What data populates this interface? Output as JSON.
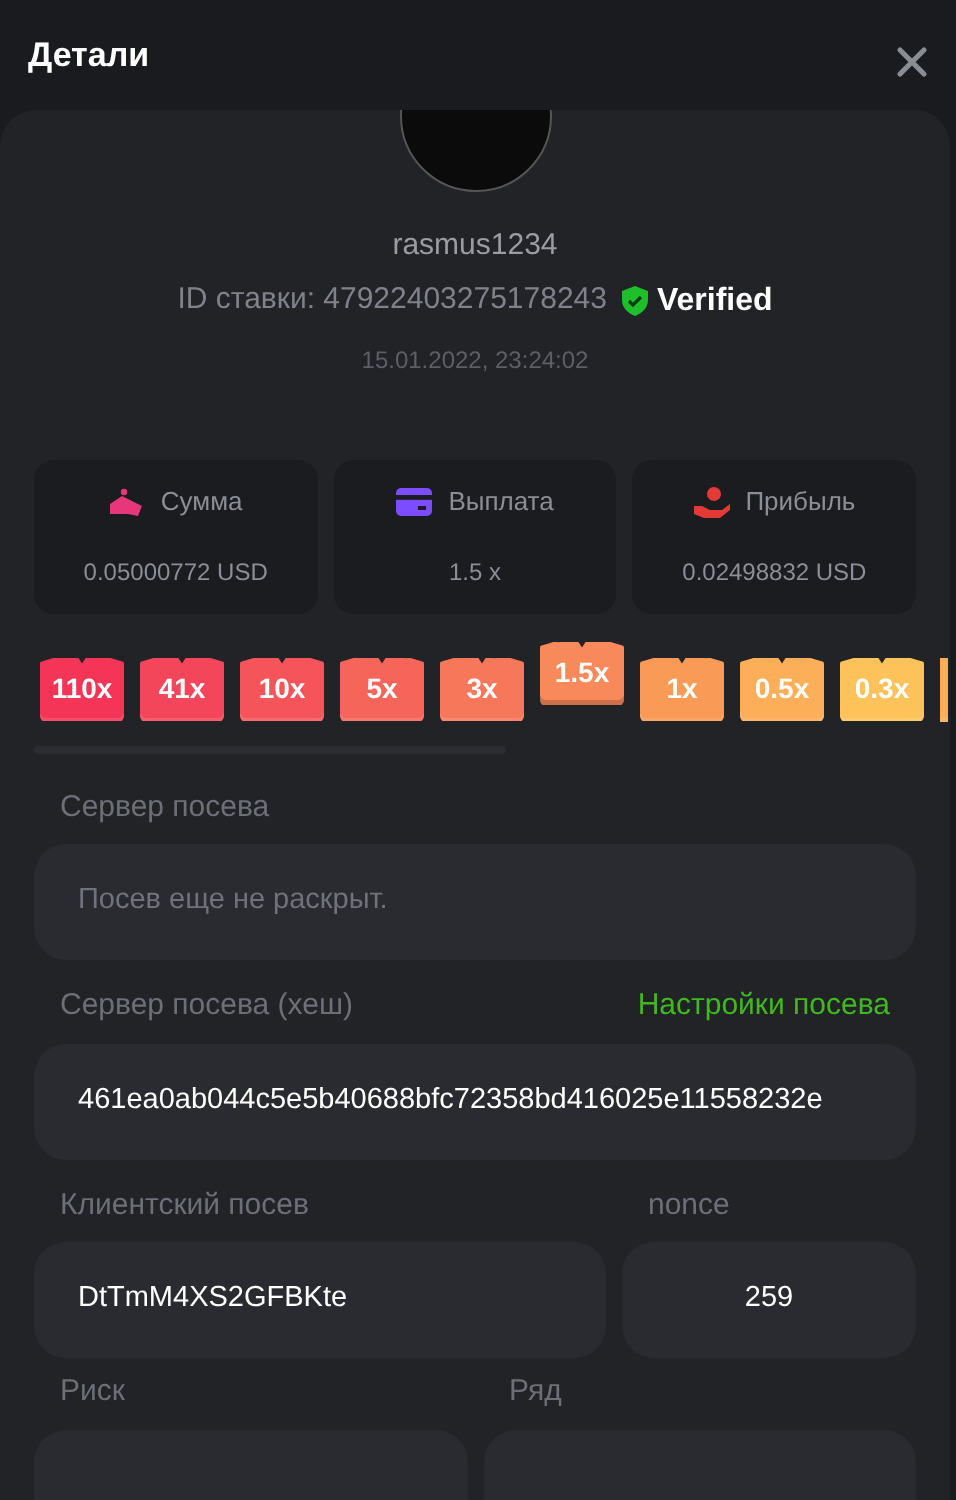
{
  "header": {
    "title": "Детали"
  },
  "player": {
    "username": "rasmus1234",
    "bet_id": "ID ставки: 47922403275178243",
    "verified": "Verified",
    "date": "15.01.2022, 23:24:02"
  },
  "stats": [
    {
      "kind": "amount",
      "label": "Сумма",
      "value": "0.05000772 USD",
      "color": "#e8367a"
    },
    {
      "kind": "payout",
      "label": "Выплата",
      "value": "1.5 x",
      "color": "#7b4dff"
    },
    {
      "kind": "profit",
      "label": "Прибыль",
      "value": "0.02498832 USD",
      "color": "#e53935"
    }
  ],
  "multipliers": [
    {
      "label": "110x",
      "color": "#f43558",
      "selected": false
    },
    {
      "label": "41x",
      "color": "#f4465a",
      "selected": false
    },
    {
      "label": "10x",
      "color": "#f5555a",
      "selected": false
    },
    {
      "label": "5x",
      "color": "#f6655a",
      "selected": false
    },
    {
      "label": "3x",
      "color": "#f7775a",
      "selected": false
    },
    {
      "label": "1.5x",
      "color": "#f8895a",
      "selected": true
    },
    {
      "label": "1x",
      "color": "#fa9a57",
      "selected": false
    },
    {
      "label": "0.5x",
      "color": "#fcae58",
      "selected": false
    },
    {
      "label": "0.3x",
      "color": "#fec25a",
      "selected": false
    },
    {
      "kind": "partial",
      "color": "#fcae58",
      "selected": false
    }
  ],
  "server_seed": {
    "label": "Сервер посева",
    "placeholder": "Посев еще не раскрыт."
  },
  "server_seed_hash": {
    "label": "Сервер посева (хеш)",
    "link": "Настройки посева",
    "value": "461ea0ab044c5e5b40688bfc72358bd416025e11558232e"
  },
  "client_seed": {
    "label": "Клиентский посев",
    "value": "DtTmM4XS2GFBKte"
  },
  "nonce": {
    "label": "nonce",
    "value": "259"
  },
  "risk": {
    "label": "Риск"
  },
  "row": {
    "label": "Ряд"
  }
}
